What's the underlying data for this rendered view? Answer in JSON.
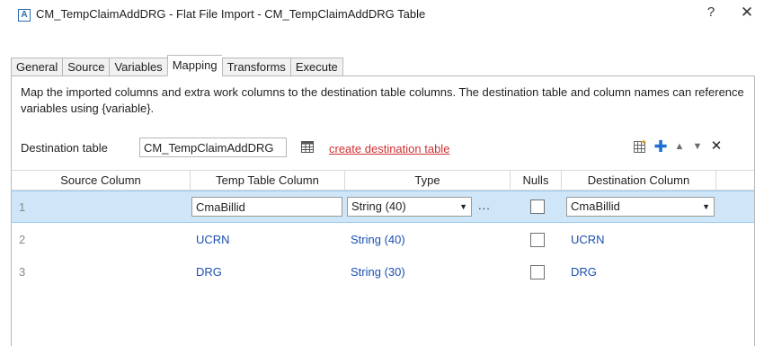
{
  "window": {
    "app_icon_letter": "A",
    "title": "CM_TempClaimAddDRG - Flat File Import - CM_TempClaimAddDRG Table",
    "help_label": "?",
    "close_label": "✕"
  },
  "tabs": [
    {
      "label": "General"
    },
    {
      "label": "Source"
    },
    {
      "label": "Variables"
    },
    {
      "label": "Mapping",
      "active": true
    },
    {
      "label": "Transforms"
    },
    {
      "label": "Execute"
    }
  ],
  "description": "Map the imported columns and extra work columns to the destination table columns. The destination table and column names can reference variables using {variable}.",
  "destination": {
    "label": "Destination table",
    "value": "CM_TempClaimAddDRG",
    "create_link": "create destination table"
  },
  "toolbar": {
    "icons": [
      "grid-icon",
      "add-icon",
      "move-up-icon",
      "move-down-icon",
      "delete-icon"
    ],
    "add_glyph": "✚",
    "up_glyph": "▲",
    "down_glyph": "▼",
    "delete_glyph": "✕"
  },
  "grid": {
    "columns": [
      "Source Column",
      "Temp Table Column",
      "Type",
      "Nulls",
      "Destination Column"
    ],
    "rows": [
      {
        "num": "1",
        "source": "",
        "temp": "CmaBillid",
        "type": "String (40)",
        "nulls": false,
        "dest": "CmaBillid",
        "selected": true
      },
      {
        "num": "2",
        "source": "",
        "temp": "UCRN",
        "type": "String (40)",
        "nulls": false,
        "dest": "UCRN",
        "selected": false
      },
      {
        "num": "3",
        "source": "",
        "temp": "DRG",
        "type": "String (30)",
        "nulls": false,
        "dest": "DRG",
        "selected": false
      }
    ],
    "ellipsis": "...",
    "caret": "▼"
  },
  "colors": {
    "selected_row": "#cfe6f8",
    "link_red": "#d03030",
    "value_blue": "#1a4fb0",
    "accent_blue": "#1f6fd0"
  }
}
